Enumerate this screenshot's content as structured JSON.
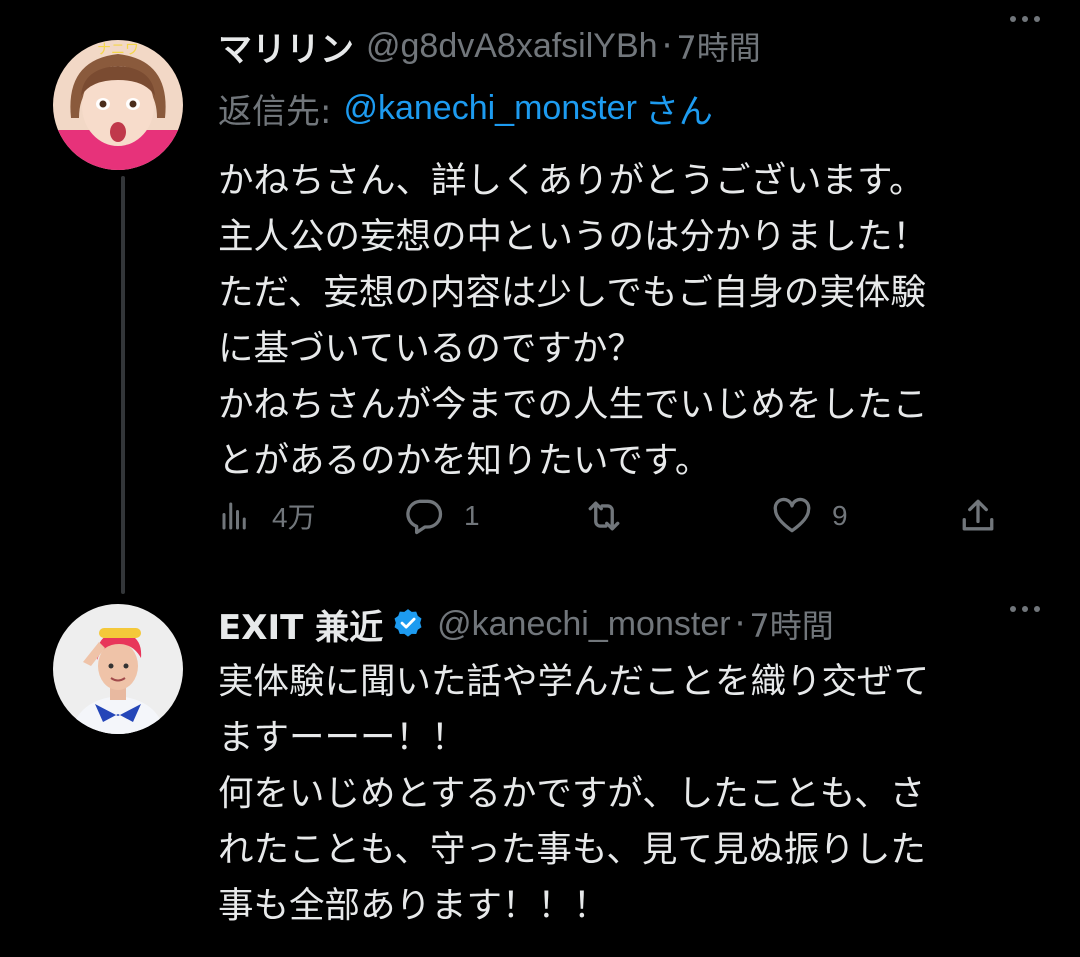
{
  "colors": {
    "background": "#000000",
    "text_primary": "#e7e9ea",
    "text_secondary": "#71767b",
    "accent": "#1d9bf0",
    "thread_line": "#333639"
  },
  "tweets": [
    {
      "display_name": "マリリン",
      "handle": "@g8dvA8xafsilYBh",
      "separator": "·",
      "time": "7時間",
      "reply_to": {
        "label": "返信先:",
        "mention": "@kanechi_monster",
        "suffix": "さん"
      },
      "lines": [
        "かねちさん、詳しくありがとうございます。",
        "主人公の妄想の中というのは分かりました！",
        "ただ、妄想の内容は少しでもご自身の実体験",
        "に基づいているのですか？",
        "かねちさんが今までの人生でいじめをしたこ",
        "とがあるのかを知りたいです。"
      ],
      "actions": {
        "views": "4万",
        "replies": "1",
        "retweets": "",
        "likes": "9"
      },
      "icons": [
        "analytics-icon",
        "reply-icon",
        "retweet-icon",
        "like-icon",
        "share-icon",
        "more-icon"
      ]
    },
    {
      "display_name": "EXIT 兼近",
      "handle": "@kanechi_monster",
      "separator": "·",
      "time": "7時間",
      "verified": true,
      "lines": [
        "実体験に聞いた話や学んだことを織り交ぜて",
        "ますーーー！！",
        "何をいじめとするかですが、したことも、さ",
        "れたことも、守った事も、見て見ぬ振りした",
        "事も全部あります！！！"
      ],
      "icons": [
        "verified-badge-icon",
        "more-icon"
      ]
    }
  ]
}
